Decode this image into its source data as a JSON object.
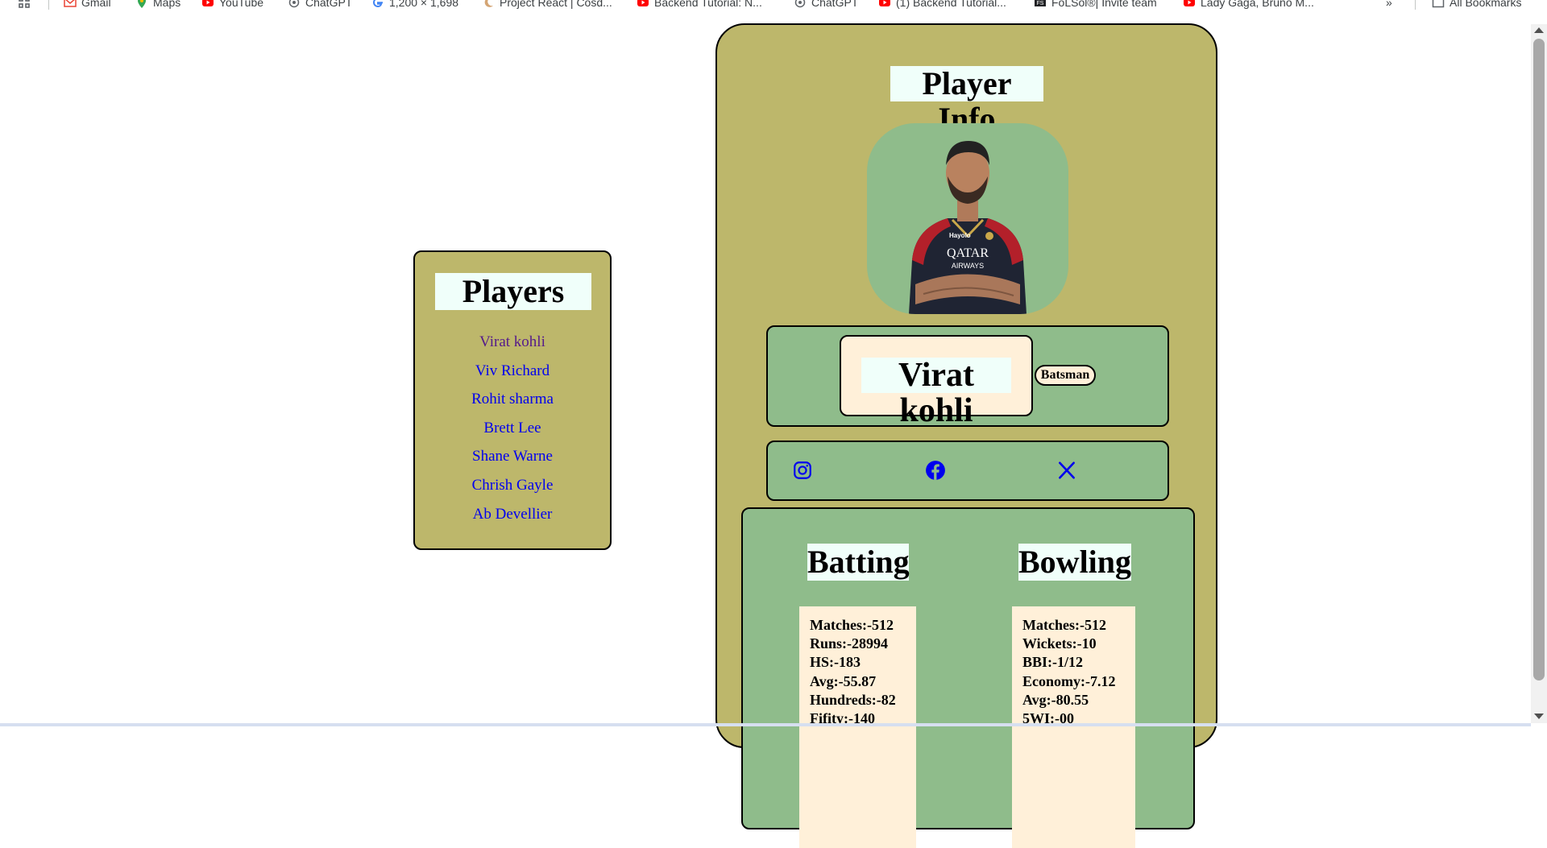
{
  "browser": {
    "bookmarks": [
      {
        "label": "Gmail",
        "icon": "gmail-icon"
      },
      {
        "label": "Maps",
        "icon": "maps-icon"
      },
      {
        "label": "YouTube",
        "icon": "youtube-icon"
      },
      {
        "label": "ChatGPT",
        "icon": "chatgpt-icon"
      },
      {
        "label": "1,200 × 1,698",
        "icon": "google-icon"
      },
      {
        "label": "Project React | Cosd...",
        "icon": "moon-icon"
      },
      {
        "label": "Backend Tutorial: N...",
        "icon": "youtube-icon"
      },
      {
        "label": "ChatGPT",
        "icon": "chatgpt-icon"
      },
      {
        "label": "(1) Backend Tutorial...",
        "icon": "youtube-icon"
      },
      {
        "label": "FoLSol®| Invite team",
        "icon": "folsol-icon"
      },
      {
        "label": "Lady Gaga, Bruno M...",
        "icon": "youtube-icon"
      }
    ],
    "overflow_label": "»",
    "all_bookmarks_label": "All Bookmarks"
  },
  "players_panel": {
    "title": "Players",
    "players": [
      "Virat kohli",
      "Viv Richard",
      "Rohit sharma",
      "Brett Lee",
      "Shane Warne",
      "Chrish Gayle",
      "Ab Devellier"
    ],
    "visited_index": 0
  },
  "player_info": {
    "title": "Player Info",
    "name": "Virat kohli",
    "role": "Batsman",
    "photo_jersey_text": [
      "Hayolo",
      "QATAR",
      "AIRWAYS"
    ],
    "social": [
      "instagram-icon",
      "facebook-icon",
      "x-icon"
    ],
    "batting": {
      "heading": "Batting",
      "stats": [
        "Matches:-512",
        "Runs:-28994",
        "HS:-183",
        "Avg:-55.87",
        "Hundreds:-82",
        "Fifity:-140"
      ]
    },
    "bowling": {
      "heading": "Bowling",
      "stats": [
        "Matches:-512",
        "Wickets:-10",
        "BBI:-1/12",
        "Economy:-7.12",
        "Avg:-80.55",
        "5WI:-00"
      ]
    }
  },
  "colors": {
    "card_bg": "#bdb76b",
    "panel_bg": "#8fbc8b",
    "heading_bg": "#f0fffa",
    "label_bg": "#fff0d9",
    "link": "#0000ee",
    "visited_link": "#551a8b"
  }
}
